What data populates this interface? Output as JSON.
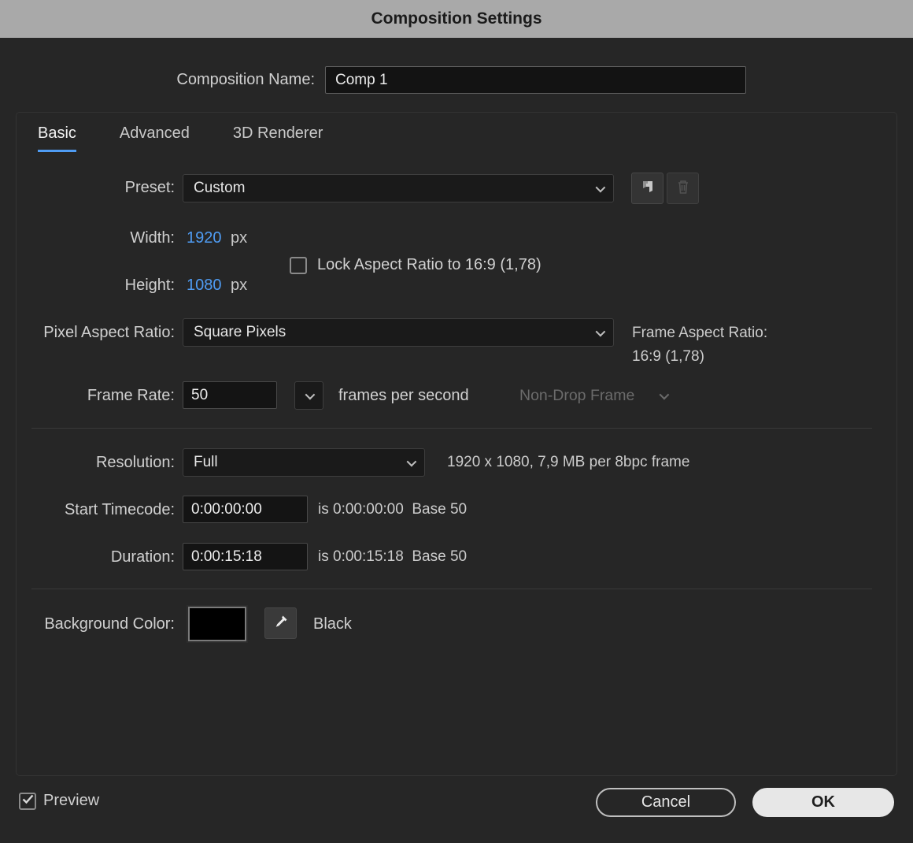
{
  "titlebar": {
    "title": "Composition Settings"
  },
  "name_row": {
    "label": "Composition Name:",
    "value": "Comp 1"
  },
  "tabs": {
    "basic": "Basic",
    "advanced": "Advanced",
    "renderer": "3D Renderer"
  },
  "preset": {
    "label": "Preset:",
    "value": "Custom"
  },
  "dimensions": {
    "width_label": "Width:",
    "width_value": "1920",
    "width_unit": "px",
    "height_label": "Height:",
    "height_value": "1080",
    "height_unit": "px",
    "lock_label": "Lock Aspect Ratio to 16:9 (1,78)",
    "lock_checked": false
  },
  "pixel_aspect": {
    "label": "Pixel Aspect Ratio:",
    "value": "Square Pixels",
    "frame_aspect_label": "Frame Aspect Ratio:",
    "frame_aspect_value": "16:9 (1,78)"
  },
  "frame_rate": {
    "label": "Frame Rate:",
    "value": "50",
    "unit": "frames per second",
    "drop_frame_value": "Non-Drop Frame"
  },
  "resolution": {
    "label": "Resolution:",
    "value": "Full",
    "info": "1920 x 1080, 7,9 MB per 8bpc frame"
  },
  "start_timecode": {
    "label": "Start Timecode:",
    "value": "0:00:00:00",
    "info": "is 0:00:00:00  Base 50"
  },
  "duration": {
    "label": "Duration:",
    "value": "0:00:15:18",
    "info": "is 0:00:15:18  Base 50"
  },
  "background": {
    "label": "Background Color:",
    "color_name": "Black",
    "color_hex": "#000000"
  },
  "footer": {
    "preview_label": "Preview",
    "preview_checked": true,
    "cancel_label": "Cancel",
    "ok_label": "OK"
  },
  "colors": {
    "accent_blue": "#4f9cf3",
    "dialog_bg": "#262626",
    "titlebar_bg": "#a9a9a9"
  }
}
